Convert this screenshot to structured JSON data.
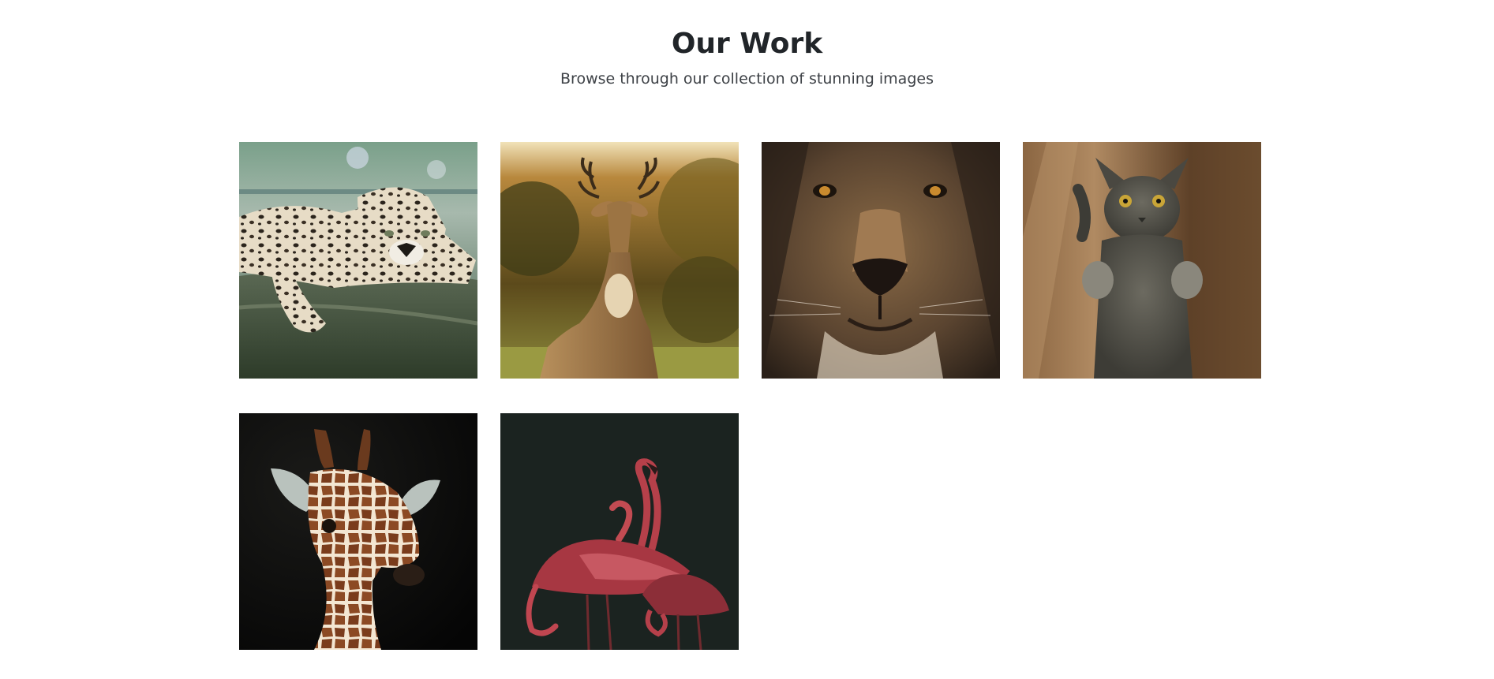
{
  "section": {
    "title": "Our Work",
    "subtitle": "Browse through our collection of stunning images"
  },
  "gallery": {
    "items": [
      {
        "subject": "leopard-photo"
      },
      {
        "subject": "deer-photo"
      },
      {
        "subject": "lion-photo"
      },
      {
        "subject": "cat-photo"
      },
      {
        "subject": "giraffe-photo"
      },
      {
        "subject": "flamingos-photo"
      }
    ]
  }
}
